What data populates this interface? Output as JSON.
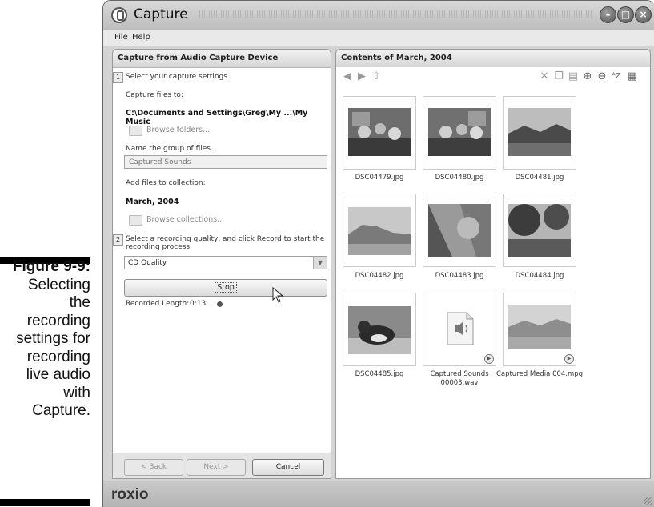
{
  "figure": {
    "label": "Figure 9-9:",
    "caption_lines": [
      "Selecting",
      "the",
      "recording",
      "settings for",
      "recording",
      "live audio",
      "with",
      "Capture."
    ]
  },
  "window": {
    "title": "Capture",
    "menu": [
      "File",
      "Help"
    ]
  },
  "left_panel": {
    "header": "Capture from Audio Capture Device",
    "step1_num": "1",
    "step1_text": "Select your capture settings.",
    "capture_files_label": "Capture files to:",
    "capture_path": "C:\\Documents and Settings\\Greg\\My ...\\My Music",
    "browse_folders": "Browse folders...",
    "group_label": "Name the group of files.",
    "group_value": "Captured Sounds",
    "collection_label": "Add files to collection:",
    "collection_value": "March, 2004",
    "browse_collections": "Browse collections...",
    "step2_num": "2",
    "step2_text_line1": "Select a recording quality, and click Record to start the",
    "step2_text_line2": "recording process.",
    "quality": "CD Quality",
    "stop_label": "Stop",
    "recorded_length_label": "Recorded Length:",
    "recorded_length_value": "0:13",
    "back_label": "< Back",
    "next_label": "Next >",
    "cancel_label": "Cancel"
  },
  "right_panel": {
    "header": "Contents of March, 2004",
    "items": [
      {
        "label": "DSC04479.jpg"
      },
      {
        "label": "DSC04480.jpg"
      },
      {
        "label": "DSC04481.jpg"
      },
      {
        "label": "DSC04482.jpg"
      },
      {
        "label": "DSC04483.jpg"
      },
      {
        "label": "DSC04484.jpg"
      },
      {
        "label": "DSC04485.jpg"
      },
      {
        "label": "Captured Sounds 00003.wav"
      },
      {
        "label": "Captured Media 004.mpg"
      }
    ]
  },
  "statusbar": {
    "logo": "roxio"
  }
}
